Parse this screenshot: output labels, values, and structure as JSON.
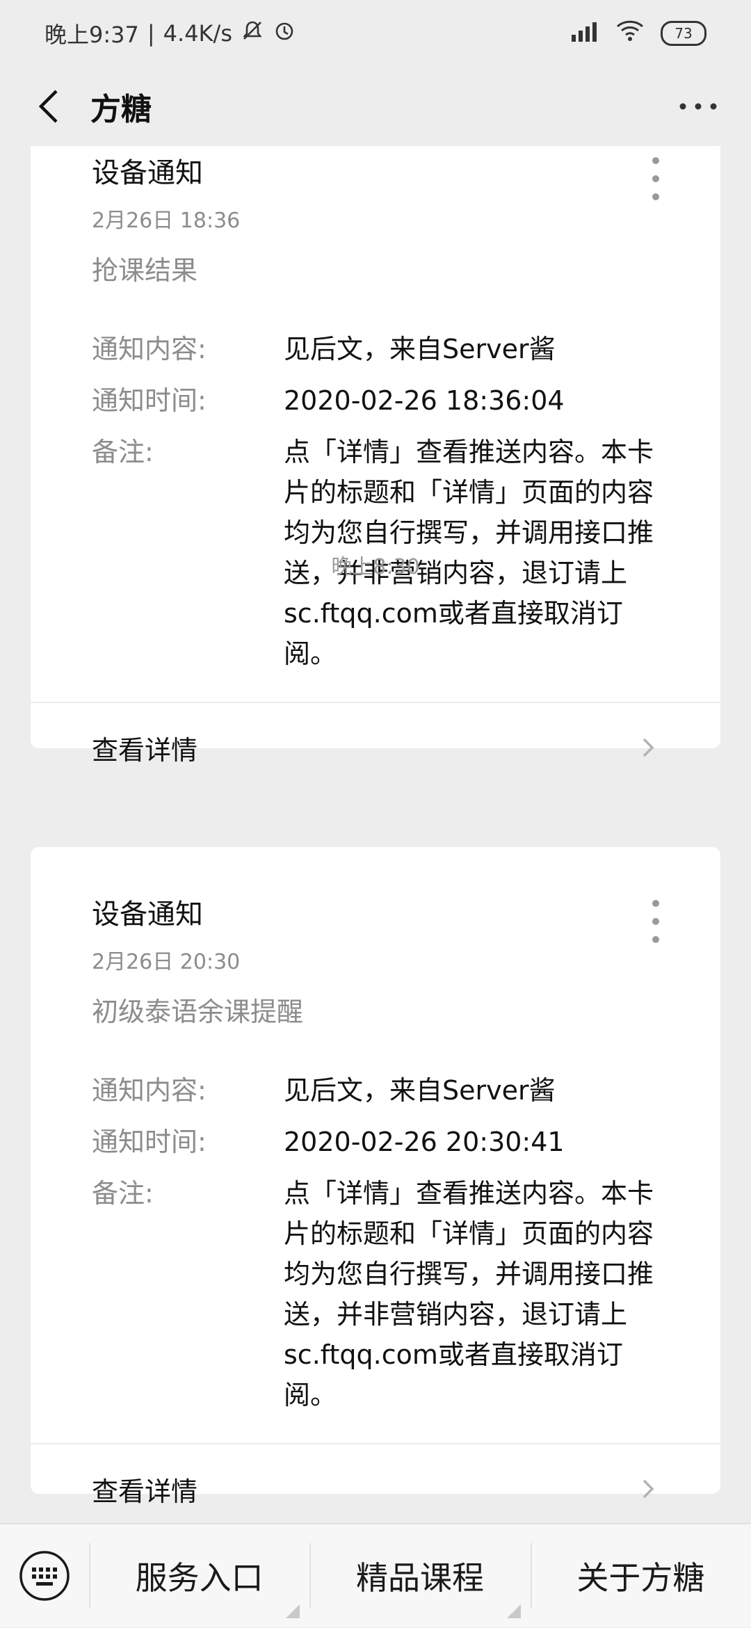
{
  "status_bar": {
    "time": "晚上9:37",
    "speed": "4.4K/s",
    "battery": "73"
  },
  "nav": {
    "title": "方糖"
  },
  "messages": [
    {
      "title": "设备通知",
      "date": "2月26日  18:36",
      "subtitle": "抢课结果",
      "rows": [
        {
          "label": "通知内容:",
          "value": "见后文，来自Server酱"
        },
        {
          "label": "通知时间:",
          "value": "2020-02-26 18:36:04"
        },
        {
          "label": "备注:",
          "value": "点「详情」查看推送内容。本卡片的标题和「详情」页面的内容均为您自行撰写，并调用接口推送，并非营销内容，退订请上sc.ftqq.com或者直接取消订阅。"
        }
      ],
      "detail_label": "查看详情"
    },
    {
      "title": "设备通知",
      "date": "2月26日  20:30",
      "subtitle": "初级泰语余课提醒",
      "rows": [
        {
          "label": "通知内容:",
          "value": "见后文，来自Server酱"
        },
        {
          "label": "通知时间:",
          "value": "2020-02-26 20:30:41"
        },
        {
          "label": "备注:",
          "value": "点「详情」查看推送内容。本卡片的标题和「详情」页面的内容均为您自行撰写，并调用接口推送，并非营销内容，退订请上sc.ftqq.com或者直接取消订阅。"
        }
      ],
      "detail_label": "查看详情"
    }
  ],
  "timestamp_between": "晚上8:30",
  "bottom_menu": {
    "items": [
      "服务入口",
      "精品课程",
      "关于方糖"
    ]
  }
}
